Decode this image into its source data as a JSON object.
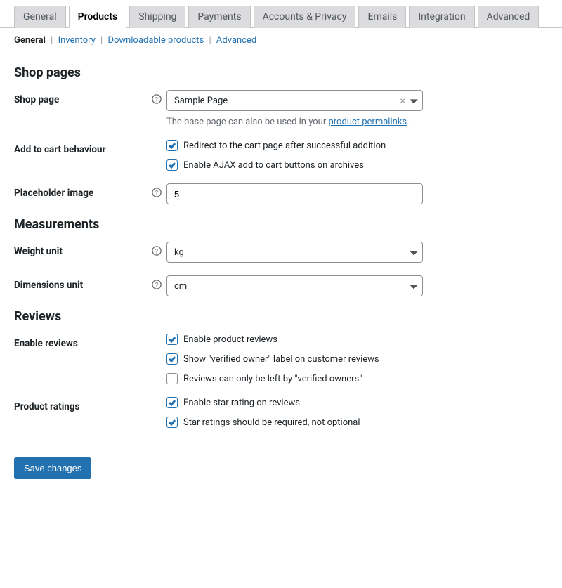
{
  "tabs": {
    "general": "General",
    "products": "Products",
    "shipping": "Shipping",
    "payments": "Payments",
    "accounts": "Accounts & Privacy",
    "emails": "Emails",
    "integration": "Integration",
    "advanced": "Advanced"
  },
  "subtabs": {
    "general": "General",
    "inventory": "Inventory",
    "downloadable": "Downloadable products",
    "advanced": "Advanced"
  },
  "sections": {
    "shop_pages": "Shop pages",
    "measurements": "Measurements",
    "reviews": "Reviews"
  },
  "labels": {
    "shop_page": "Shop page",
    "add_to_cart": "Add to cart behaviour",
    "placeholder_image": "Placeholder image",
    "weight_unit": "Weight unit",
    "dimensions_unit": "Dimensions unit",
    "enable_reviews": "Enable reviews",
    "product_ratings": "Product ratings"
  },
  "fields": {
    "shop_page_value": "Sample Page",
    "shop_page_desc_pre": "The base page can also be used in your ",
    "shop_page_desc_link": "product permalinks",
    "shop_page_desc_post": ".",
    "cart_redirect": "Redirect to the cart page after successful addition",
    "cart_ajax": "Enable AJAX add to cart buttons on archives",
    "placeholder_value": "5",
    "weight_value": "kg",
    "dimensions_value": "cm",
    "reviews_enable": "Enable product reviews",
    "reviews_verified_label": "Show \"verified owner\" label on customer reviews",
    "reviews_verified_only": "Reviews can only be left by \"verified owners\"",
    "ratings_enable": "Enable star rating on reviews",
    "ratings_required": "Star ratings should be required, not optional"
  },
  "buttons": {
    "save": "Save changes"
  }
}
